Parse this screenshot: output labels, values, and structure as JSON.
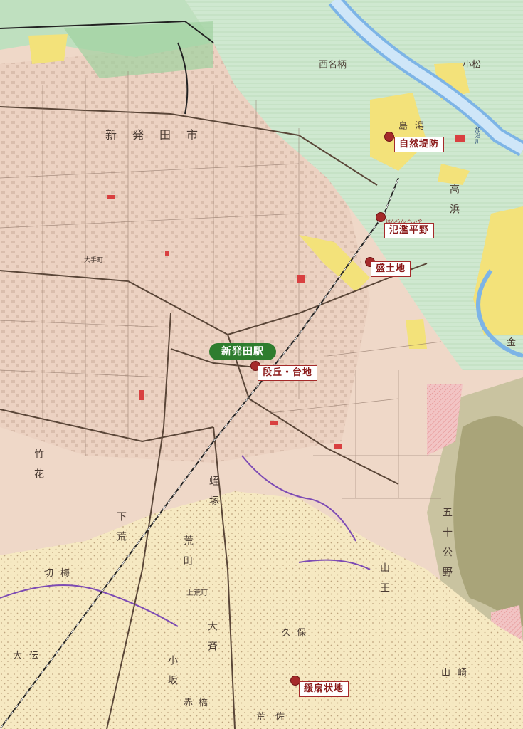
{
  "map": {
    "station": "新発田駅",
    "landforms": [
      {
        "id": "natural-levee",
        "name": "自然堤防",
        "ruby": ""
      },
      {
        "id": "floodplain",
        "name": "氾濫平野",
        "ruby": "はんらん へいや"
      },
      {
        "id": "fill",
        "name": "盛土地",
        "ruby": ""
      },
      {
        "id": "terrace",
        "name": "段丘・台地",
        "ruby": ""
      },
      {
        "id": "alluvial-fan",
        "name": "緩扇状地",
        "ruby": ""
      }
    ],
    "place_names": {
      "city": "新発田市",
      "nishinaka": "西名柄",
      "komatsu": "小松",
      "shimagata": "島潟",
      "takahama": "高浜",
      "takehana": "竹花",
      "kirimume": "切梅",
      "shimoara": "下荒",
      "arachou": "荒町",
      "kamiarachou": "上荒町",
      "hiruzuka": "蛭塚",
      "kubo": "久保",
      "ohsugi": "大斉",
      "yamanouchi": "山王",
      "gojukogai": "五十公野",
      "sanzaki": "山崎",
      "oden": "大伝",
      "kokubo": "小坂",
      "akahashi": "赤橋",
      "arasa": "荒佐",
      "kin": "金",
      "taisho": "大手町"
    },
    "river": "加治川"
  },
  "colors": {
    "accent": "#a52a2a",
    "station": "#2e7d2e"
  }
}
